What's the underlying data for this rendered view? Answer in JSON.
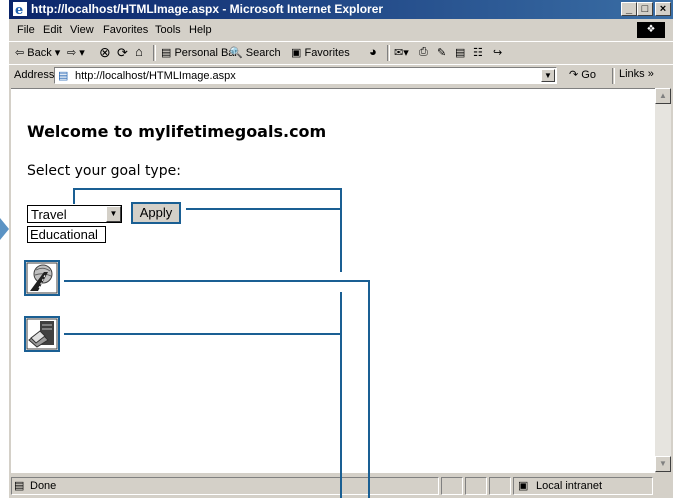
{
  "window": {
    "title": "http://localhost/HTMLImage.aspx - Microsoft Internet Explorer",
    "buttons": [
      "_",
      "□",
      "×"
    ]
  },
  "menu": [
    "File",
    "Edit",
    "View",
    "Favorites",
    "Tools",
    "Help"
  ],
  "toolbar": {
    "back": "⇦ Back ▾",
    "forward": "⇨ ▾",
    "personal_bar": "Personal Bar",
    "search": "Search",
    "favorites": "Favorites"
  },
  "address": {
    "label": "Address",
    "value": "http://localhost/HTMLImage.aspx",
    "go": "Go",
    "links": "Links »"
  },
  "page": {
    "heading": "Welcome to mylifetimegoals.com",
    "prompt": "Select your goal type:",
    "select_value": "Travel",
    "option_visible": "Educational",
    "apply_label": "Apply"
  },
  "status": {
    "text": "Done",
    "zone": "Local intranet"
  },
  "icons": {
    "image1": "travel-road-icon",
    "image2": "education-books-icon"
  },
  "colors": {
    "callout": "#1a5f93",
    "titlebar": "#0a246a"
  }
}
